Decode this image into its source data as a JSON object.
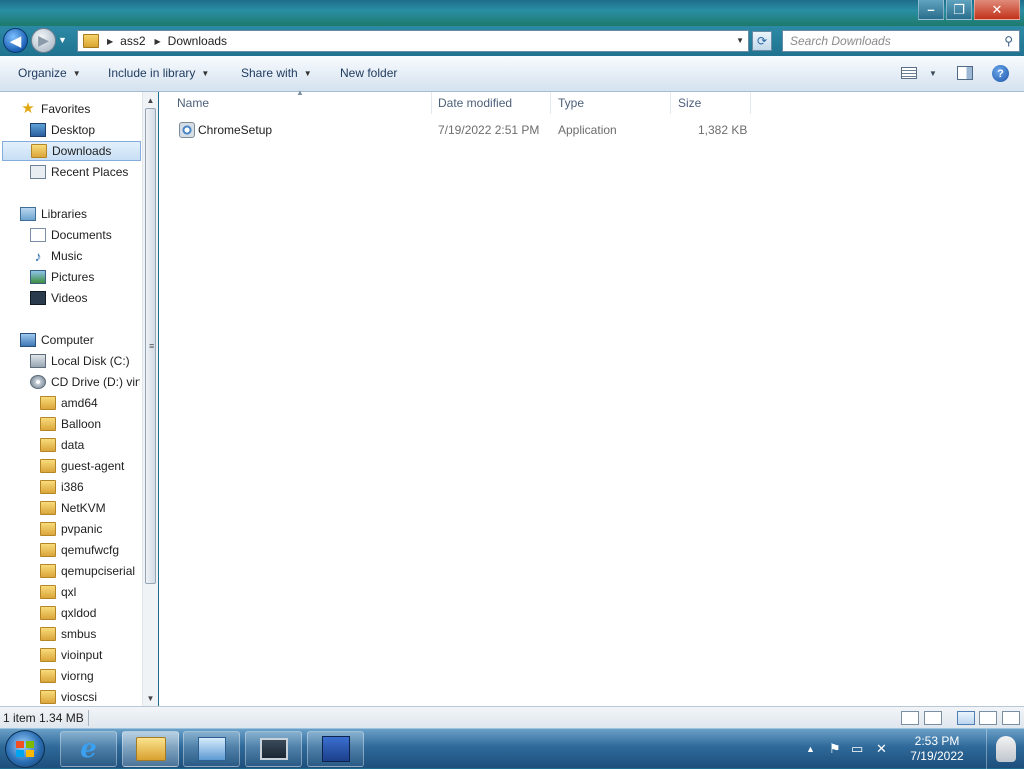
{
  "window": {
    "minimize": "–",
    "maximize": "❐",
    "close": "✕"
  },
  "address_bar": {
    "breadcrumbs": [
      "ass2",
      "Downloads"
    ],
    "search_placeholder": "Search Downloads"
  },
  "toolbar": {
    "organize": "Organize",
    "include_in_library": "Include in library",
    "share_with": "Share with",
    "new_folder": "New folder",
    "help": "?"
  },
  "navigation": {
    "favorites": {
      "label": "Favorites",
      "items": [
        "Desktop",
        "Downloads",
        "Recent Places"
      ]
    },
    "libraries": {
      "label": "Libraries",
      "items": [
        "Documents",
        "Music",
        "Pictures",
        "Videos"
      ]
    },
    "computer": {
      "label": "Computer",
      "drives": [
        "Local Disk (C:)",
        "CD Drive (D:) virt"
      ],
      "cd_folders": [
        "amd64",
        "Balloon",
        "data",
        "guest-agent",
        "i386",
        "NetKVM",
        "pvpanic",
        "qemufwcfg",
        "qemupciserial",
        "qxl",
        "qxldod",
        "smbus",
        "vioinput",
        "viorng",
        "vioscsi"
      ]
    },
    "selected": "Downloads"
  },
  "file_list": {
    "columns": [
      "Name",
      "Date modified",
      "Type",
      "Size"
    ],
    "rows": [
      {
        "name": "ChromeSetup",
        "date_modified": "7/19/2022 2:51 PM",
        "type": "Application",
        "size": "1,382 KB"
      }
    ]
  },
  "status_bar": {
    "text": "1 item 1.34 MB"
  },
  "taskbar": {
    "ie_glyph": "e",
    "clock_time": "2:53 PM",
    "clock_date": "7/19/2022"
  },
  "colors": {
    "selection": "#c7dff5",
    "accent": "#1d6b8f",
    "taskbar": "#2f6a9a"
  }
}
